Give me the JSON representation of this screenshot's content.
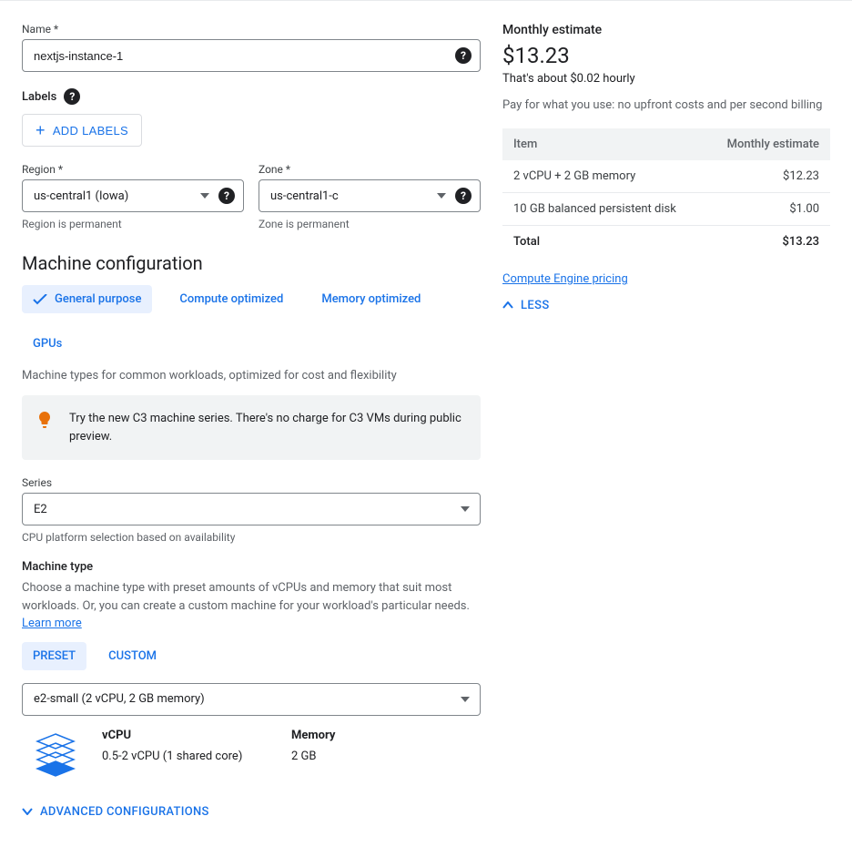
{
  "name": {
    "label": "Name *",
    "value": "nextjs-instance-1"
  },
  "labels": {
    "heading": "Labels",
    "add_btn": "ADD LABELS"
  },
  "region": {
    "label": "Region *",
    "value": "us-central1 (Iowa)",
    "helper": "Region is permanent"
  },
  "zone": {
    "label": "Zone *",
    "value": "us-central1-c",
    "helper": "Zone is permanent"
  },
  "machine_config": {
    "title": "Machine configuration",
    "tabs": [
      "General purpose",
      "Compute optimized",
      "Memory optimized",
      "GPUs"
    ],
    "desc": "Machine types for common workloads, optimized for cost and flexibility",
    "tip": "Try the new C3 machine series. There's no charge for C3 VMs during public preview.",
    "series": {
      "label": "Series",
      "value": "E2",
      "helper": "CPU platform selection based on availability"
    },
    "machine_type": {
      "label": "Machine type",
      "desc": "Choose a machine type with preset amounts of vCPUs and memory that suit most workloads. Or, you can create a custom machine for your workload's particular needs. ",
      "learn_more": "Learn more",
      "sub_tabs": [
        "PRESET",
        "CUSTOM"
      ],
      "value": "e2-small (2 vCPU, 2 GB memory)",
      "vcpu_label": "vCPU",
      "vcpu_value": "0.5-2 vCPU (1 shared core)",
      "memory_label": "Memory",
      "memory_value": "2 GB"
    },
    "advanced": "ADVANCED CONFIGURATIONS"
  },
  "estimate": {
    "title": "Monthly estimate",
    "price": "$13.23",
    "hourly": "That's about $0.02 hourly",
    "note": "Pay for what you use: no upfront costs and per second billing",
    "table": {
      "h1": "Item",
      "h2": "Monthly estimate",
      "rows": [
        {
          "item": "2 vCPU + 2 GB memory",
          "cost": "$12.23"
        },
        {
          "item": "10 GB balanced persistent disk",
          "cost": "$1.00"
        }
      ],
      "total_label": "Total",
      "total_cost": "$13.23"
    },
    "pricing_link": "Compute Engine pricing",
    "less": "LESS"
  }
}
